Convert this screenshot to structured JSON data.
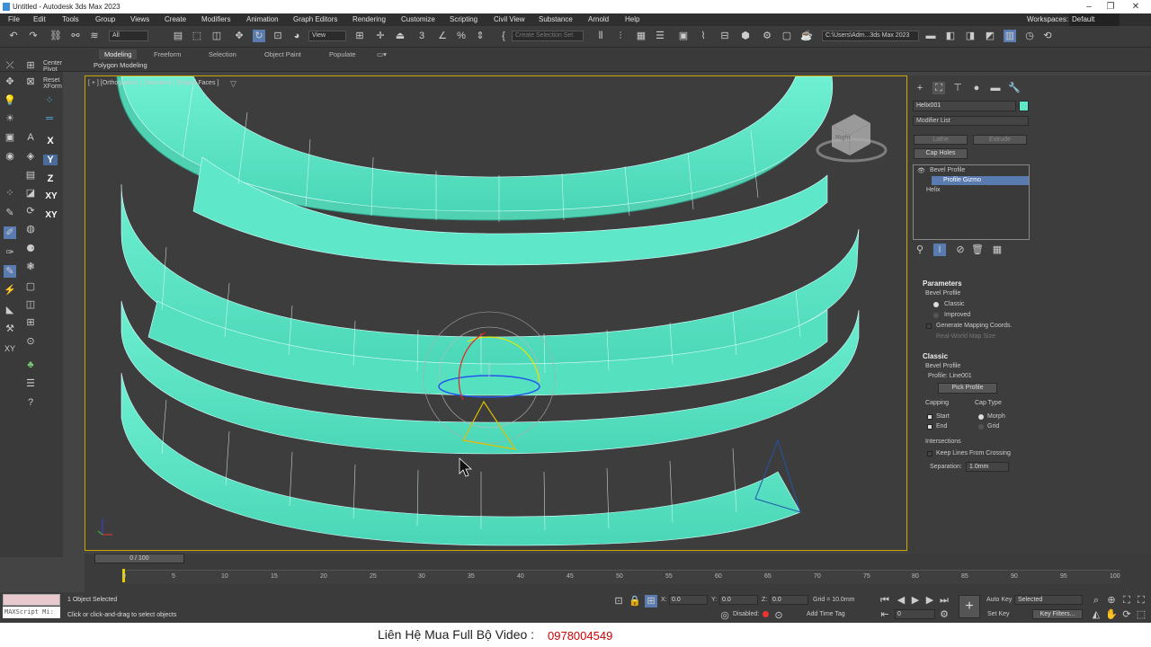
{
  "window": {
    "title": "Untitled - Autodesk 3ds Max 2023"
  },
  "menu": [
    "File",
    "Edit",
    "Tools",
    "Group",
    "Views",
    "Create",
    "Modifiers",
    "Animation",
    "Graph Editors",
    "Rendering",
    "Customize",
    "Scripting",
    "Civil View",
    "Substance",
    "Arnold",
    "Help"
  ],
  "workspace": {
    "label": "Workspaces:",
    "value": "Default"
  },
  "toolbar": {
    "filter": "All",
    "refcoord": "View",
    "selset_placeholder": "Create Selection Set",
    "path": "C:\\Users\\Adm...3ds Max 2023"
  },
  "ribbon": {
    "tabs": [
      "Modeling",
      "Freeform",
      "Selection",
      "Object Paint",
      "Populate"
    ],
    "active": "Modeling",
    "sub": "Polygon Modeling"
  },
  "left": {
    "center_pivot": "Center Pivot",
    "reset_xform": "Reset XForm",
    "axes": [
      "X",
      "Y",
      "Z",
      "XY",
      "XY"
    ]
  },
  "viewport": {
    "label": "[ + ] [Orthographic ] [Standard ] [Edged Faces ]",
    "viewcube": "Right"
  },
  "command": {
    "object_name": "Helix001",
    "object_color": "#5ee7c8",
    "modifier_list": "Modifier List",
    "buttons": [
      "Lathe",
      "Extrude",
      "Cap Holes"
    ],
    "stack": [
      "Bevel Profile",
      "Profile Gizmo",
      "Helix"
    ],
    "parameters": {
      "title": "Parameters",
      "bevel_profile": "Bevel Profile",
      "options": [
        "Classic",
        "Improved"
      ],
      "selected": "Classic",
      "gen_map": "Generate Mapping Coords.",
      "real_world": "Real-World Map Size"
    },
    "classic": {
      "title": "Classic",
      "bevel_profile": "Bevel Profile",
      "profile": "Profile: Line001",
      "pick": "Pick Profile",
      "capping": "Capping",
      "start": "Start",
      "end": "End",
      "cap_type": "Cap Type",
      "morph": "Morph",
      "grid": "Grid",
      "intersections": "Intersections",
      "keep_lines": "Keep Lines From Crossing",
      "separation_label": "Separation:",
      "separation": "1.0mm"
    }
  },
  "timeline": {
    "frame": "0 / 100",
    "ticks": [
      "0",
      "5",
      "10",
      "15",
      "20",
      "25",
      "30",
      "35",
      "40",
      "45",
      "50",
      "55",
      "60",
      "65",
      "70",
      "75",
      "80",
      "85",
      "90",
      "95",
      "100"
    ]
  },
  "status": {
    "maxscript": "MAXScript Mi:",
    "selected": "1 Object Selected",
    "hint": "Click or click-and-drag to select objects",
    "x": "0.0",
    "y": "0.0",
    "z": "0.0",
    "grid": "Grid = 10.0mm",
    "disabled": "Disabled:",
    "add_time_tag": "Add Time Tag",
    "auto_key": "Auto Key",
    "set_key": "Set Key",
    "key_mode": "Selected",
    "key_filters": "Key Filters...",
    "frame": "0"
  },
  "banner": {
    "text": "Liên Hệ Mua Full Bộ Video :",
    "phone": "0978004549"
  }
}
